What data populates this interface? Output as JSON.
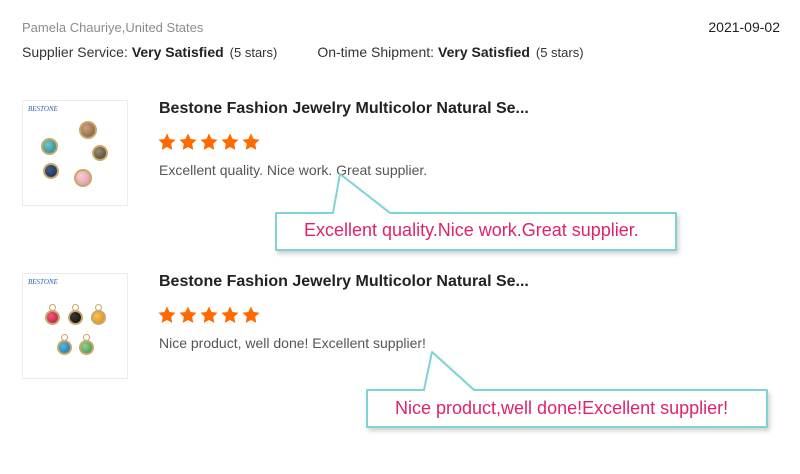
{
  "reviewer": "Pamela Chauriye,United States",
  "date": "2021-09-02",
  "ratings": {
    "supplier_label": "Supplier Service:",
    "supplier_value": "Very Satisfied",
    "supplier_stars": "(5 stars)",
    "shipment_label": "On-time Shipment:",
    "shipment_value": "Very Satisfied",
    "shipment_stars": "(5 stars)"
  },
  "reviews": [
    {
      "brand": "BESTONE",
      "title": "Bestone Fashion Jewelry Multicolor Natural Se...",
      "stars": 5,
      "comment": "Excellent quality. Nice work. Great supplier.",
      "callout": "Excellent quality.Nice work.Great supplier."
    },
    {
      "brand": "BESTONE",
      "title": "Bestone Fashion Jewelry Multicolor Natural Se...",
      "stars": 5,
      "comment": "Nice product, well done! Excellent supplier!",
      "callout": "Nice product,well done!Excellent supplier!"
    }
  ],
  "colors": {
    "star": "#ff6a00",
    "callout_border": "#7fd3d6",
    "callout_text": "#e0226e"
  }
}
